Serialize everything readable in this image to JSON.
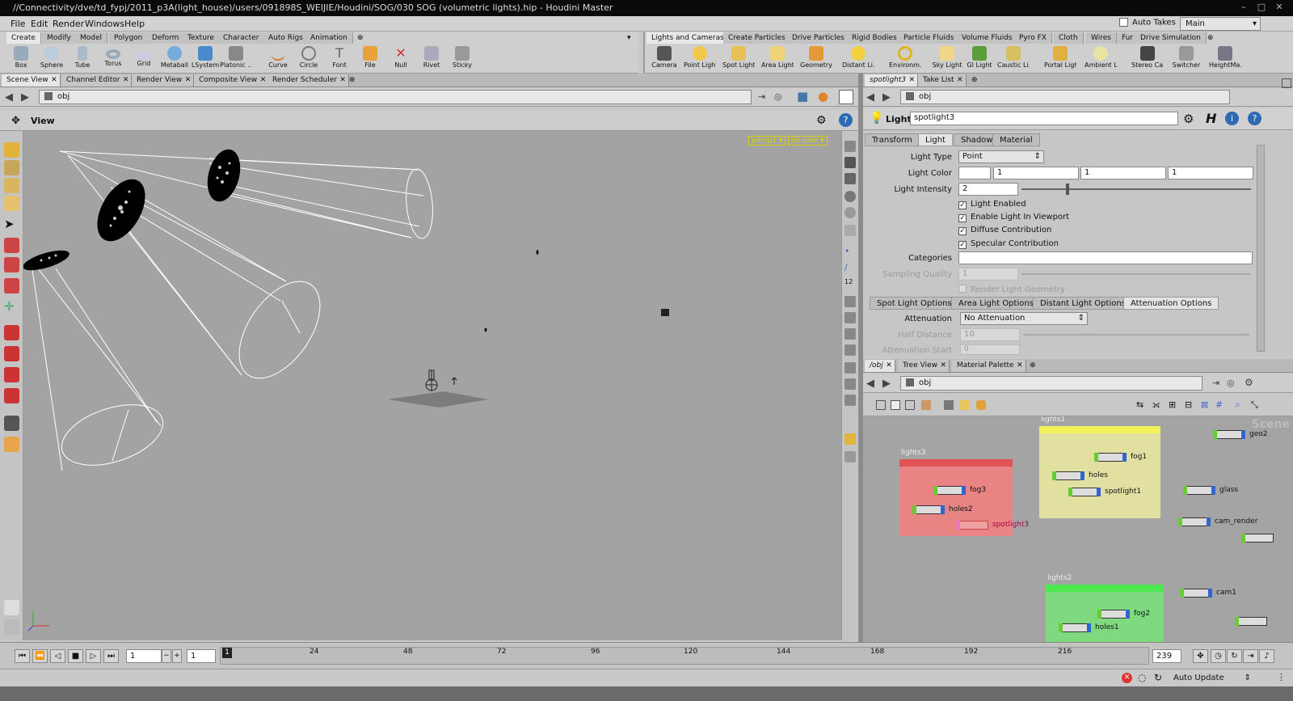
{
  "window": {
    "title": "//Connectivity/dve/td_fypj/2011_p3A(light_house)/users/091898S_WEIJIE/Houdini/SOG/030 SOG (volumetric lights).hip - Houdini Master"
  },
  "menu": [
    "File",
    "Edit",
    "Render",
    "Windows",
    "Help"
  ],
  "top_right": {
    "auto_takes": "Auto Takes",
    "desktop": "Main"
  },
  "shelf_left": {
    "tabs": [
      "Create",
      "Modify",
      "Model",
      "Polygon",
      "Deform",
      "Texture",
      "Character",
      "Auto Rigs",
      "Animation"
    ],
    "tools": [
      "Box",
      "Sphere",
      "Tube",
      "Torus",
      "Grid",
      "Metaball",
      "LSystem",
      "Platonic ...",
      "Curve",
      "Circle",
      "Font",
      "File",
      "Null",
      "Rivet",
      "Sticky"
    ]
  },
  "shelf_right": {
    "tabs": [
      "Lights and Cameras",
      "Create Particles",
      "Drive Particles",
      "Rigid Bodies",
      "Particle Fluids",
      "Volume Fluids",
      "Pyro FX",
      "Cloth",
      "Wires",
      "Fur",
      "Drive Simulation"
    ],
    "tools": [
      "Camera",
      "Point Light",
      "Spot Light",
      "Area Light",
      "Geometry...",
      "Distant Li...",
      "Environm...",
      "Sky Light",
      "GI Light",
      "Caustic Li...",
      "Portal Light",
      "Ambient L...",
      "Stereo Ca...",
      "Switcher",
      "HeightMa..."
    ]
  },
  "viewer": {
    "tabs": [
      "Scene View",
      "Channel Editor",
      "Render View",
      "Composite View",
      "Render Scheduler"
    ],
    "path": "obj",
    "header": "View",
    "persp": "persp1",
    "cam": "no cam"
  },
  "params": {
    "tabs": [
      "spotlight3",
      "Take List"
    ],
    "path": "obj",
    "node_type": "Light",
    "node_name": "spotlight3",
    "sub_tabs": [
      "Transform",
      "Light",
      "Shadow",
      "Material"
    ],
    "light_type_label": "Light Type",
    "light_type": "Point",
    "light_color_label": "Light Color",
    "light_color": [
      "1",
      "1",
      "1"
    ],
    "intensity_label": "Light Intensity",
    "intensity": "2",
    "checkboxes": [
      "Light Enabled",
      "Enable Light In Viewport",
      "Diffuse Contribution",
      "Specular Contribution"
    ],
    "categories_label": "Categories",
    "sampling_label": "Sampling Quality",
    "sampling": "1",
    "render_geo": "Render Light Geometry",
    "option_tabs": [
      "Spot Light Options",
      "Area Light Options",
      "Distant Light Options",
      "Attenuation Options"
    ],
    "attenuation_label": "Attenuation",
    "attenuation": "No Attenuation",
    "half_distance_label": "Half Distance",
    "half_distance": "10",
    "atten_start_label": "Attenuation Start",
    "atten_start": "0"
  },
  "network": {
    "tabs": [
      "/obj",
      "Tree View",
      "Material Palette"
    ],
    "path": "obj",
    "watermark": "Scene",
    "boxes": [
      {
        "name": "lights3",
        "nodes": [
          "fog3",
          "holes2",
          "spotlight3"
        ]
      },
      {
        "name": "lights1",
        "nodes": [
          "fog1",
          "holes",
          "spotlight1"
        ]
      },
      {
        "name": "lights2",
        "nodes": [
          "fog2",
          "holes1"
        ]
      }
    ],
    "loose_nodes": [
      "geo2",
      "glass",
      "cam_render",
      "cam1"
    ]
  },
  "timeline": {
    "frame": "1",
    "start": "1",
    "end": "239",
    "current_marker": "1",
    "ticks": [
      "24",
      "48",
      "72",
      "96",
      "120",
      "144",
      "168",
      "192",
      "216"
    ]
  },
  "status": {
    "auto_update": "Auto Update"
  },
  "colors": {
    "lights3_box": "#e88484",
    "lights1_box": "#e2e0a0",
    "lights2_box": "#7fd97f",
    "viewport_bg": "#a3a3a3"
  }
}
